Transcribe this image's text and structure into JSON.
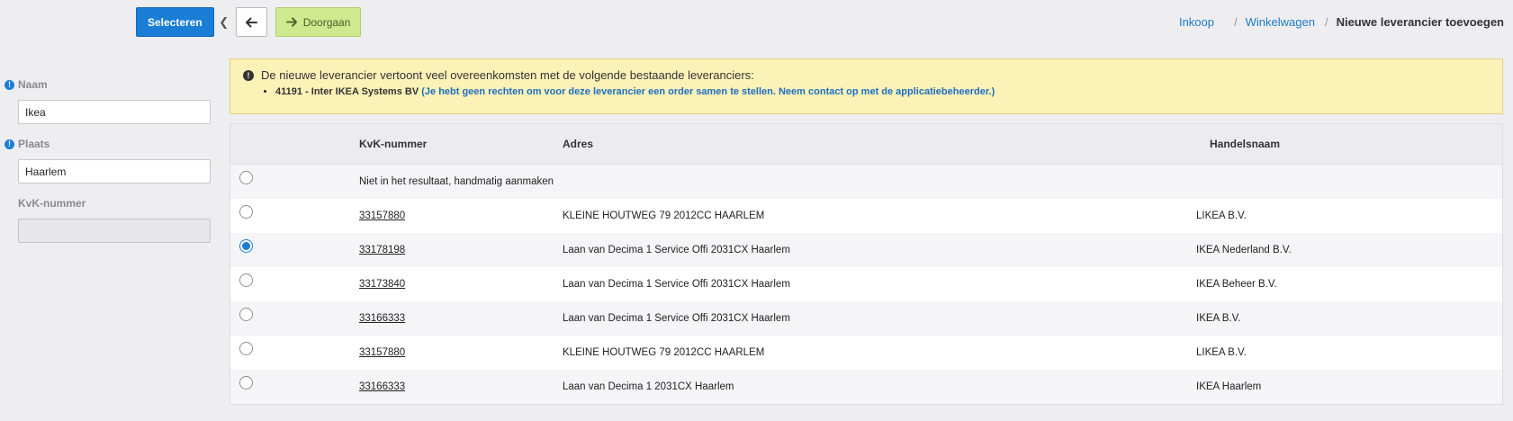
{
  "toolbar": {
    "select_label": "Selecteren",
    "continue_label": "Doorgaan"
  },
  "breadcrumb": {
    "items": [
      "Inkoop",
      "Winkelwagen"
    ],
    "current": "Nieuwe leverancier toevoegen"
  },
  "form": {
    "naam": {
      "label": "Naam",
      "value": "Ikea"
    },
    "plaats": {
      "label": "Plaats",
      "value": "Haarlem"
    },
    "kvk": {
      "label": "KvK-nummer",
      "value": ""
    }
  },
  "alert": {
    "title": "De nieuwe leverancier vertoont veel overeenkomsten met de volgende bestaande leveranciers:",
    "supplier": "41191 - Inter IKEA Systems BV",
    "note": "(Je hebt geen rechten om voor deze leverancier een order samen te stellen. Neem contact op met de applicatiebeheerder.)"
  },
  "table": {
    "headers": {
      "kvk": "KvK-nummer",
      "adres": "Adres",
      "handelsnaam": "Handelsnaam"
    },
    "manual_label": "Niet in het resultaat, handmatig aanmaken",
    "rows": [
      {
        "kvk": "33157880",
        "adres": "KLEINE HOUTWEG 79 2012CC HAARLEM",
        "handelsnaam": "LIKEA B.V."
      },
      {
        "kvk": "33178198",
        "adres": "Laan van Decima 1 Service Offi 2031CX Haarlem",
        "handelsnaam": "IKEA Nederland B.V."
      },
      {
        "kvk": "33173840",
        "adres": "Laan van Decima 1 Service Offi 2031CX Haarlem",
        "handelsnaam": "IKEA Beheer B.V."
      },
      {
        "kvk": "33166333",
        "adres": "Laan van Decima 1 Service Offi 2031CX Haarlem",
        "handelsnaam": "IKEA B.V."
      },
      {
        "kvk": "33157880",
        "adres": "KLEINE HOUTWEG 79 2012CC HAARLEM",
        "handelsnaam": "LIKEA B.V."
      },
      {
        "kvk": "33166333",
        "adres": "Laan van Decima 1 2031CX Haarlem",
        "handelsnaam": "IKEA Haarlem"
      }
    ],
    "selected_index": 1
  },
  "colors": {
    "primary": "#1a7ed6",
    "continue_bg": "#cfe98e",
    "alert_bg": "#fcf2b8"
  }
}
